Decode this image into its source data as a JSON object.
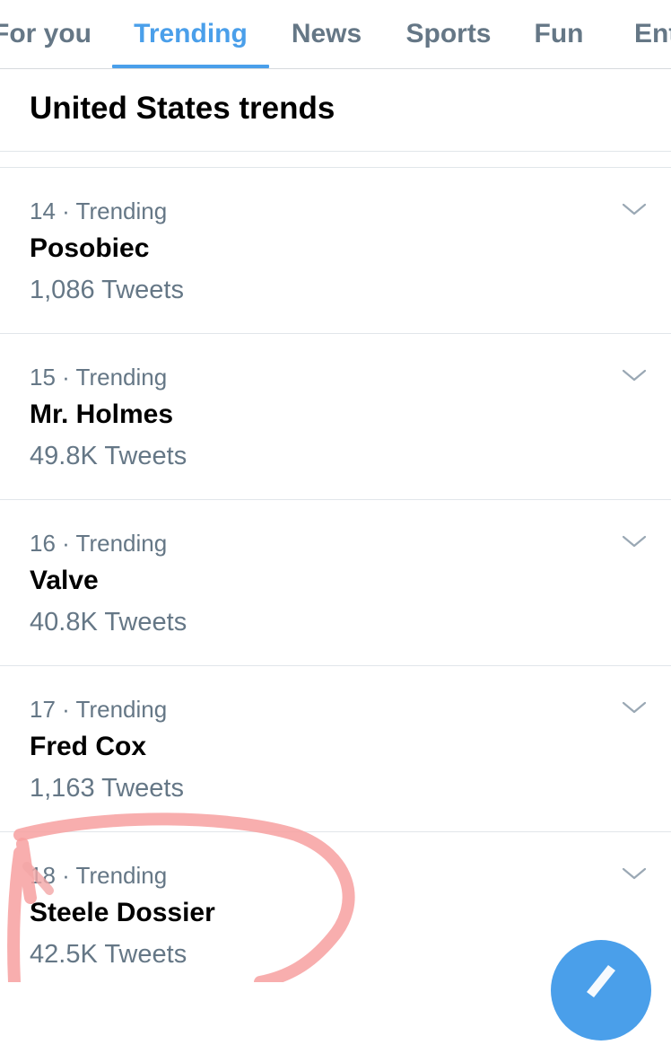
{
  "tabs": [
    {
      "label": "For you"
    },
    {
      "label": "Trending",
      "active": true
    },
    {
      "label": "News"
    },
    {
      "label": "Sports"
    },
    {
      "label": "Fun"
    },
    {
      "label": "Ent"
    }
  ],
  "section": {
    "title": "United States trends"
  },
  "trends": [
    {
      "meta": "14 · Trending",
      "name": "Posobiec",
      "count": "1,086 Tweets"
    },
    {
      "meta": "15 · Trending",
      "name": "Mr. Holmes",
      "count": "49.8K Tweets"
    },
    {
      "meta": "16 · Trending",
      "name": "Valve",
      "count": "40.8K Tweets"
    },
    {
      "meta": "17 · Trending",
      "name": "Fred Cox",
      "count": "1,163 Tweets"
    },
    {
      "meta": "18 · Trending",
      "name": "Steele Dossier",
      "count": "42.5K Tweets"
    }
  ],
  "icons": {
    "chevron": "chevron-down-icon",
    "compose": "compose-tweet-icon"
  },
  "colors": {
    "accent": "#4a9fea",
    "secondary_text": "#657786",
    "annotation": "#f7a0a0"
  }
}
